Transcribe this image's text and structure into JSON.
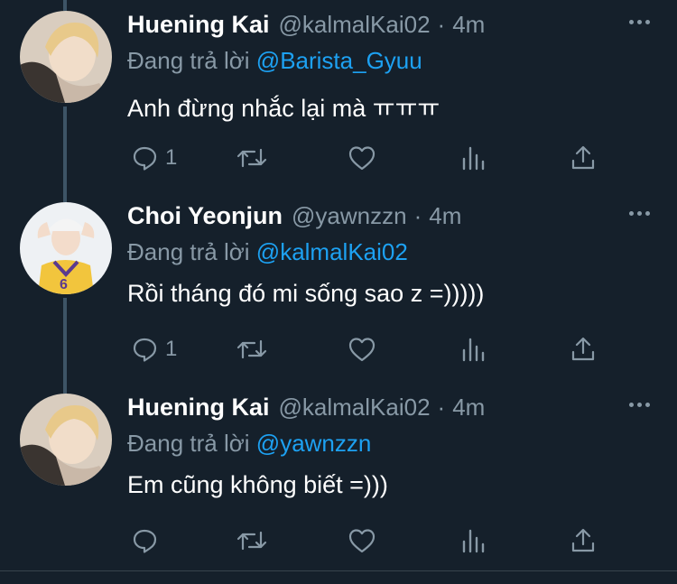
{
  "colors": {
    "background": "#15202b",
    "text_primary": "#ffffff",
    "text_secondary": "#8899a6",
    "mention": "#1da1f2",
    "thread_line": "#3d5466"
  },
  "tweets": [
    {
      "display_name": "Huening Kai",
      "handle": "@kalmalKai02",
      "separator": "·",
      "time": "4m",
      "reply_prefix": "Đang trả lời",
      "reply_to": "@Barista_Gyuu",
      "text": "Anh đừng nhắc lại mà ㅠㅠㅠ",
      "reply_count": "1",
      "avatar_icon": "avatar-blond-boy"
    },
    {
      "display_name": "Choi Yeonjun",
      "handle": "@yawnzzn",
      "separator": "·",
      "time": "4m",
      "reply_prefix": "Đang trả lời",
      "reply_to": "@kalmalKai02",
      "text": "Rồi tháng đó mi sống sao z =)))))",
      "reply_count": "1",
      "avatar_icon": "avatar-lakers-jersey"
    },
    {
      "display_name": "Huening Kai",
      "handle": "@kalmalKai02",
      "separator": "·",
      "time": "4m",
      "reply_prefix": "Đang trả lời",
      "reply_to": "@yawnzzn",
      "text": "Em cũng không biết =)))",
      "reply_count": "",
      "avatar_icon": "avatar-blond-boy"
    }
  ],
  "icons": [
    "reply-icon",
    "retweet-icon",
    "like-icon",
    "analytics-icon",
    "share-icon",
    "more-icon"
  ]
}
